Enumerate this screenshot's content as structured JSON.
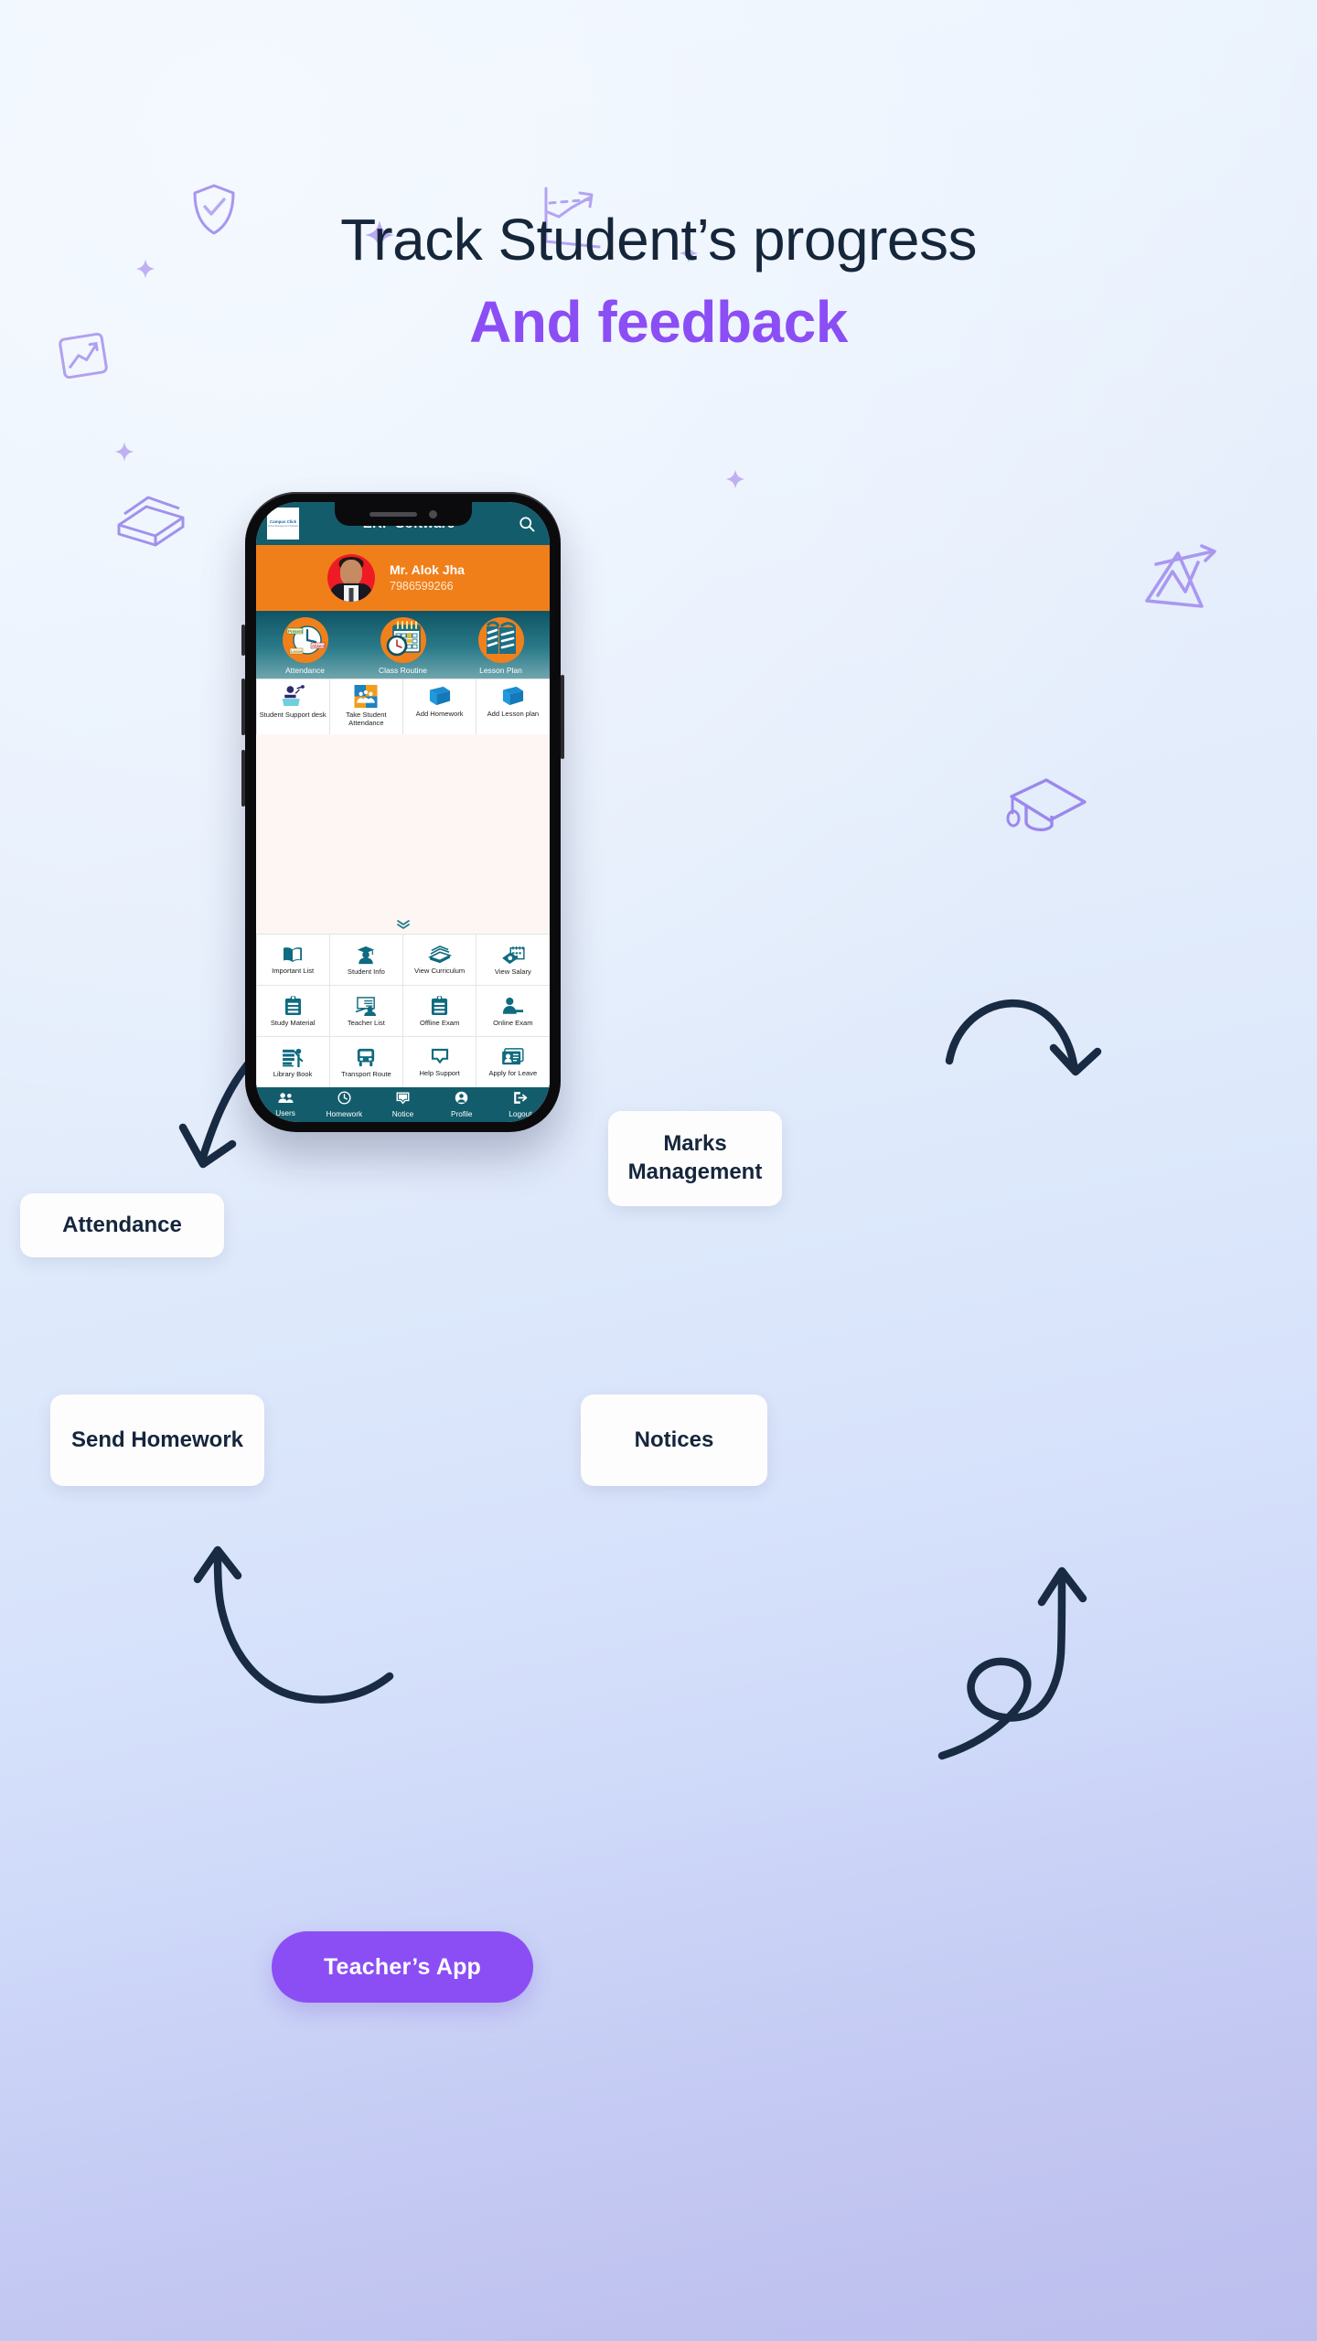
{
  "headline": {
    "line1": "Track Student’s progress",
    "line2": "And feedback",
    "accent_color": "#8b4ef5",
    "dark_color": "#16263a"
  },
  "cta": {
    "label": "Teacher’s App",
    "bg": "#8b4ef5",
    "text_color": "#ffffff"
  },
  "callouts": [
    {
      "id": "attendance",
      "label": "Attendance"
    },
    {
      "id": "send-homework",
      "label": "Send Homework"
    },
    {
      "id": "marks-management",
      "label": "Marks Management"
    },
    {
      "id": "notices",
      "label": "Notices"
    }
  ],
  "phone": {
    "appbar": {
      "title": "ERP Software",
      "bg": "#135c6b",
      "logo_text": "Campus Click",
      "logo_sub": "School Management Software",
      "search_icon": "search-icon"
    },
    "profile": {
      "name": "Mr. Alok Jha",
      "phone": "7986599266",
      "bg": "#f07f1a"
    },
    "hero_items": [
      {
        "label": "Attendance",
        "icon": "attendance-clock-icon"
      },
      {
        "label": "Class Routine",
        "icon": "calendar-clock-icon"
      },
      {
        "label": "Lesson Plan",
        "icon": "books-icon"
      }
    ],
    "quick_tiles": [
      {
        "label": "Student Support desk",
        "icon": "podium-speaker-icon"
      },
      {
        "label": "Take Student Attendance",
        "icon": "group-people-icon"
      },
      {
        "label": "Add Homework",
        "icon": "book-icon"
      },
      {
        "label": "Add Lesson plan",
        "icon": "book-icon"
      }
    ],
    "grid_tiles": [
      {
        "label": "Important List",
        "icon": "open-book-icon"
      },
      {
        "label": "Student Info",
        "icon": "graduate-student-icon"
      },
      {
        "label": "View Curriculum",
        "icon": "book-stack-icon"
      },
      {
        "label": "View Salary",
        "icon": "calendar-money-icon"
      },
      {
        "label": "Study Material",
        "icon": "clipboard-icon"
      },
      {
        "label": "Teacher List",
        "icon": "teacher-board-icon"
      },
      {
        "label": "Offline Exam",
        "icon": "clipboard-icon"
      },
      {
        "label": "Online Exam",
        "icon": "person-writing-icon"
      },
      {
        "label": "Library Book",
        "icon": "library-shelf-icon"
      },
      {
        "label": "Transport Route",
        "icon": "bus-icon"
      },
      {
        "label": "Help Support",
        "icon": "chat-box-icon"
      },
      {
        "label": "Apply for Leave",
        "icon": "id-card-icon"
      }
    ],
    "scroll_hint_icon": "chevron-double-down-icon",
    "bottom_nav": [
      {
        "label": "Users",
        "icon": "people-icon"
      },
      {
        "label": "Homework",
        "icon": "clock-icon"
      },
      {
        "label": "Notice",
        "icon": "notice-box-icon"
      },
      {
        "label": "Profile",
        "icon": "account-circle-icon"
      },
      {
        "label": "Logout",
        "icon": "logout-arrow-icon"
      }
    ],
    "teal_color": "#135c6b",
    "orange_color": "#f07f1a",
    "icon_teal": "#0f6b80"
  },
  "decor": {
    "doodles": [
      "shield-check-doodle",
      "chart-arrow-doodle",
      "photo-frame-doodle",
      "books-stack-doodle",
      "graduation-cap-doodle",
      "growth-chart-doodle",
      "sparkle-doodle"
    ],
    "arrows": [
      "curved-arrow-down-left",
      "curved-arrow-down-right",
      "curved-arrow-up-left",
      "looped-arrow-up-right"
    ],
    "doodle_color": "#a896f0"
  }
}
